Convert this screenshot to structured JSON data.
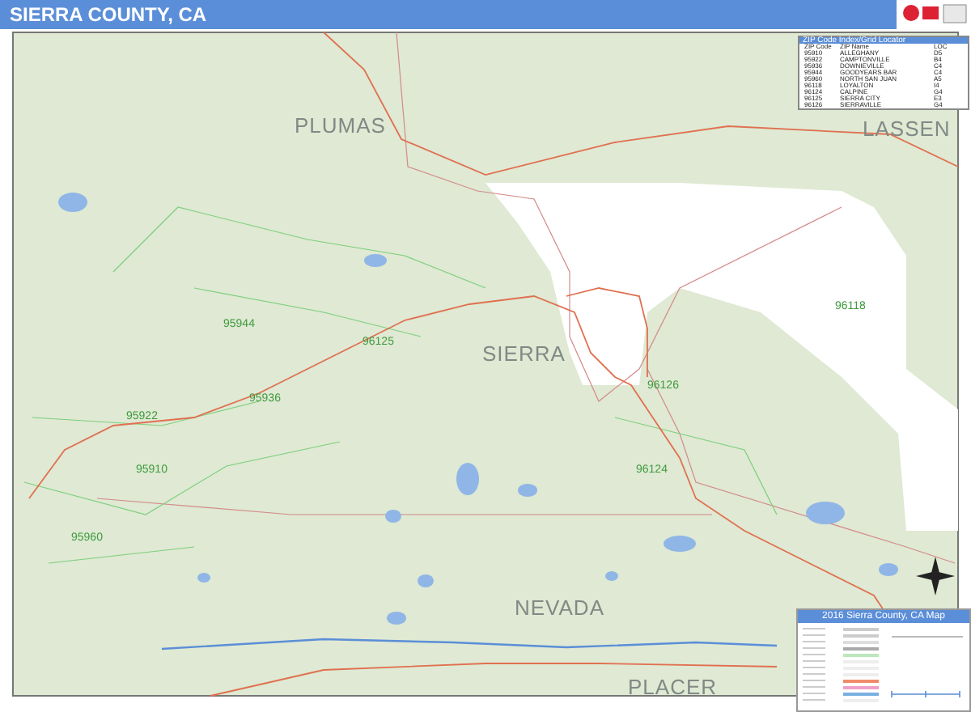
{
  "window": {
    "title": "SIERRA COUNTY, CA"
  },
  "map_labels": {
    "counties": [
      "PLUMAS",
      "LASSEN",
      "SIERRA",
      "NEVADA",
      "PLACER"
    ],
    "zip_codes": [
      "95944",
      "96125",
      "95936",
      "95922",
      "95910",
      "95960",
      "96124",
      "96126",
      "96118"
    ]
  },
  "zip_table": {
    "title": "ZIP Code Index/Grid Locator",
    "columns": [
      "ZIP Code",
      "ZIP Name",
      "LOC"
    ],
    "rows": [
      [
        "95910",
        "ALLEGHANY",
        "D5"
      ],
      [
        "95922",
        "CAMPTONVILLE",
        "B4"
      ],
      [
        "95936",
        "DOWNIEVILLE",
        "C4"
      ],
      [
        "95944",
        "GOODYEARS BAR",
        "C4"
      ],
      [
        "95960",
        "NORTH SAN JUAN",
        "A5"
      ],
      [
        "96118",
        "LOYALTON",
        "I4"
      ],
      [
        "96124",
        "CALPINE",
        "G4"
      ],
      [
        "96125",
        "SIERRA CITY",
        "E3"
      ],
      [
        "96126",
        "SIERRAVILLE",
        "G4"
      ]
    ]
  },
  "legend": {
    "title": "2016 Sierra County, CA Map"
  }
}
